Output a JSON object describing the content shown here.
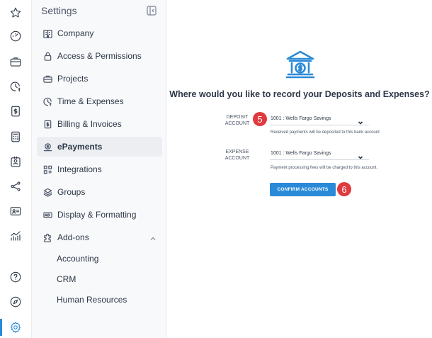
{
  "rail": {
    "icons": [
      "star-icon",
      "dashboard-gauge-icon",
      "briefcase-icon",
      "clock-dollar-icon",
      "invoice-dollar-icon",
      "calculator-icon",
      "contact-card-icon",
      "share-network-icon",
      "id-card-icon",
      "analytics-chart-icon",
      "help-icon",
      "compass-icon",
      "settings-gear-icon"
    ],
    "active": "settings-gear-icon",
    "accent": "#2b8ad8"
  },
  "settings": {
    "title": "Settings",
    "items": [
      {
        "label": "Company",
        "icon": "building-icon"
      },
      {
        "label": "Access & Permissions",
        "icon": "lock-icon"
      },
      {
        "label": "Projects",
        "icon": "briefcase-icon"
      },
      {
        "label": "Time & Expenses",
        "icon": "clock-dollar-icon"
      },
      {
        "label": "Billing & Invoices",
        "icon": "invoice-icon"
      },
      {
        "label": "ePayments",
        "icon": "payment-icon",
        "active": true
      },
      {
        "label": "Integrations",
        "icon": "integrations-icon"
      },
      {
        "label": "Groups",
        "icon": "layers-icon"
      },
      {
        "label": "Display & Formatting",
        "icon": "display-format-icon"
      },
      {
        "label": "Add-ons",
        "icon": "puzzle-icon",
        "expanded": true
      }
    ],
    "addons": [
      "Accounting",
      "CRM",
      "Human Resources"
    ]
  },
  "main": {
    "heading": "Where would you like to record your Deposits and Expenses?",
    "deposit": {
      "label_line1": "DEPOSIT",
      "label_line2": "ACCOUNT",
      "value": "1001 : Wells Fargo Savings",
      "help": "Received payments will be deposited to this bank account.",
      "badge": "5"
    },
    "expense": {
      "label_line1": "EXPENSE",
      "label_line2": "ACCOUNT",
      "value": "1001 : Wells Fargo Savings",
      "help": "Payment processing fees will be charged to this account."
    },
    "confirm": {
      "label": "CONFIRM ACCOUNTS",
      "badge": "6"
    },
    "colors": {
      "button": "#2b8ad8",
      "badge": "#e0393e",
      "bank_icon": "#2b8ad8"
    }
  }
}
